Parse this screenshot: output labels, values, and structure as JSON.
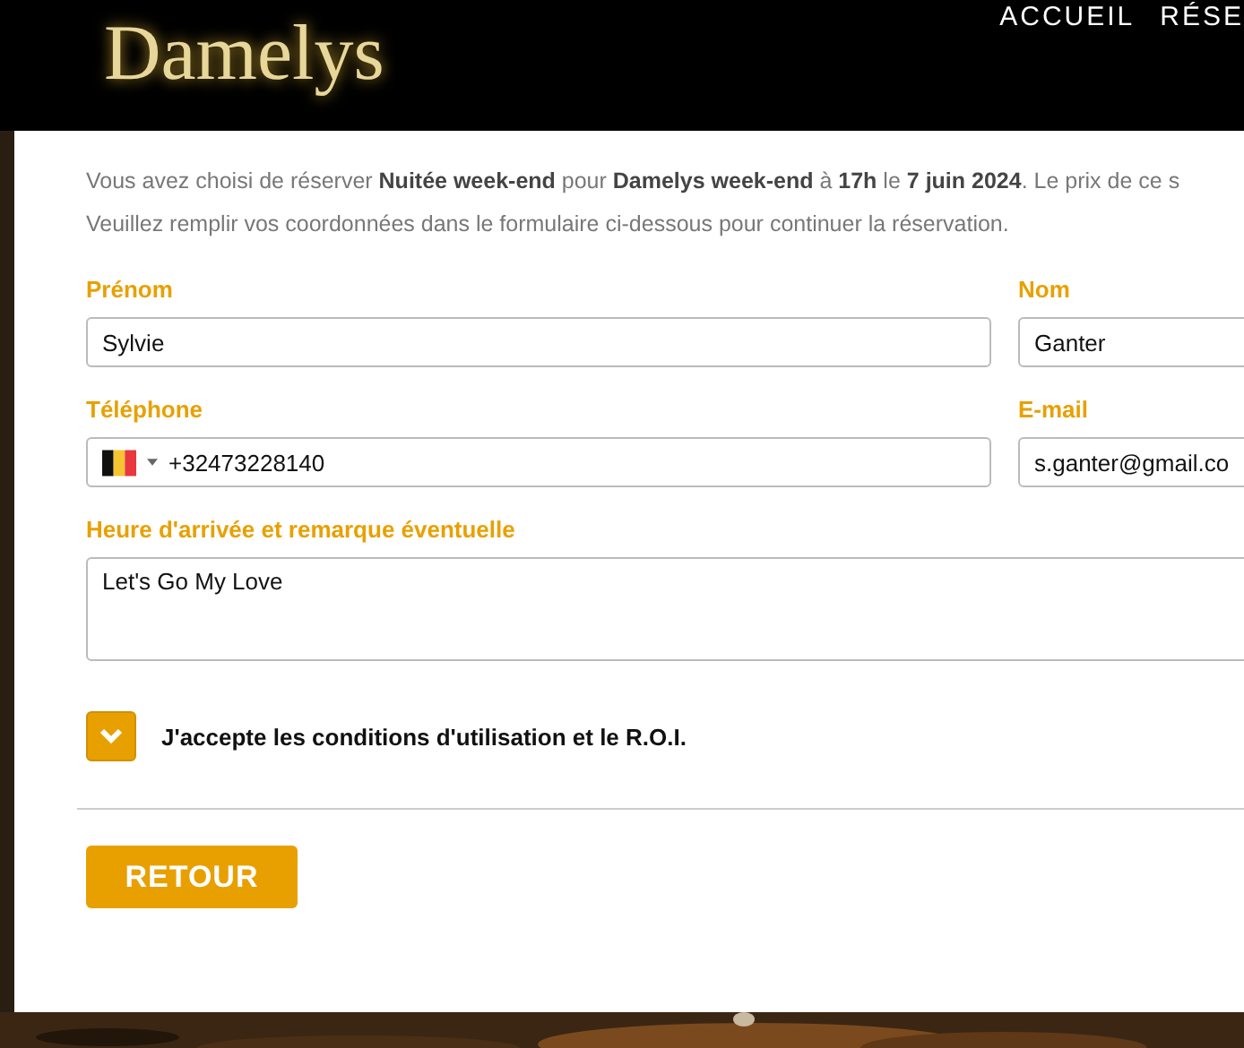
{
  "header": {
    "logo": "Damelys",
    "nav": [
      {
        "label": "ACCUEIL"
      },
      {
        "label": "RÉSE"
      }
    ]
  },
  "intro": "Vous avez choisi de réserver **Nuitée week-end** pour **Damelys week-end** à **17h** le **7 juin 2024**. Le prix de ce s",
  "instructions": "Veuillez remplir vos coordonnées dans le formulaire ci-dessous pour continuer la réservation.",
  "fields": [
    {
      "kind": "text",
      "label": "Prénom",
      "value": "Sylvie"
    },
    {
      "kind": "text",
      "label": "Nom",
      "value": "Ganter"
    },
    {
      "kind": "phone",
      "label": "Téléphone",
      "value": "+32473228140"
    },
    {
      "kind": "text",
      "label": "E-mail",
      "value": "s.ganter@gmail.co"
    },
    {
      "kind": "textarea",
      "label": "Heure d'arrivée et remarque éventuelle",
      "value": "Let's Go My Love"
    }
  ],
  "terms": {
    "label": "J'accepte les conditions d'utilisation et le R.O.I.",
    "checked": true
  },
  "back_button": "RETOUR"
}
